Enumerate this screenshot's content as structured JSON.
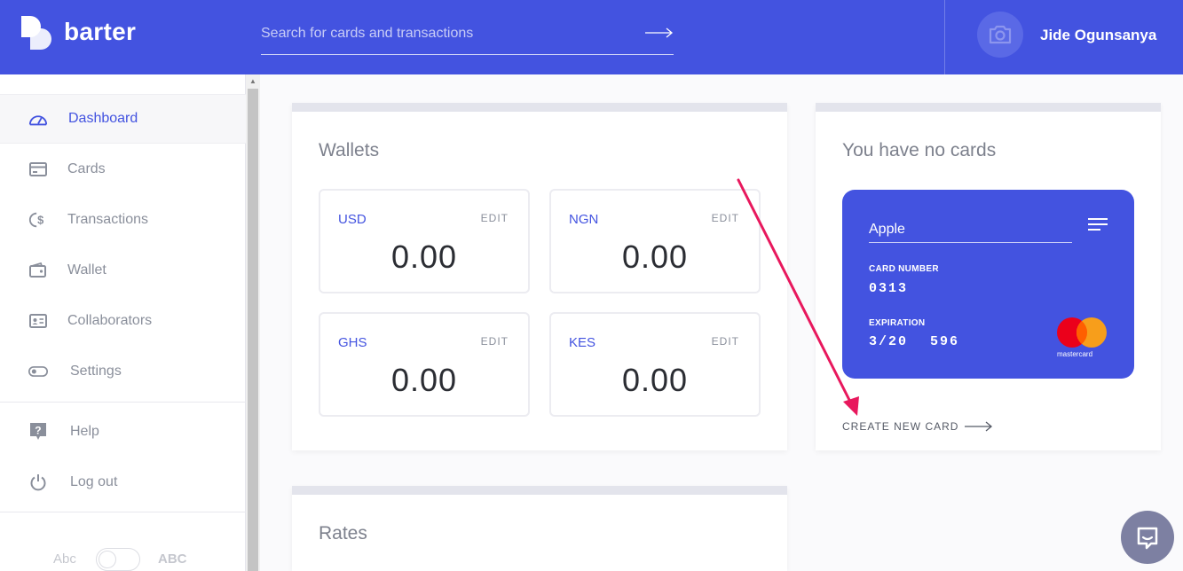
{
  "app": {
    "name": "barter"
  },
  "search": {
    "placeholder": "Search for cards and transactions"
  },
  "user": {
    "name": "Jide Ogunsanya"
  },
  "sidebar": {
    "items": [
      {
        "label": "Dashboard",
        "icon": "dashboard-icon",
        "active": true
      },
      {
        "label": "Cards",
        "icon": "card-icon"
      },
      {
        "label": "Transactions",
        "icon": "transactions-icon"
      },
      {
        "label": "Wallet",
        "icon": "wallet-icon"
      },
      {
        "label": "Collaborators",
        "icon": "collaborators-icon"
      },
      {
        "label": "Settings",
        "icon": "settings-icon"
      },
      {
        "label": "Help",
        "icon": "help-icon"
      },
      {
        "label": "Log out",
        "icon": "power-icon"
      }
    ],
    "text_size": {
      "small": "Abc",
      "large": "ABC"
    }
  },
  "wallets": {
    "title": "Wallets",
    "items": [
      {
        "currency": "USD",
        "edit": "EDIT",
        "amount": "0.00"
      },
      {
        "currency": "NGN",
        "edit": "EDIT",
        "amount": "0.00"
      },
      {
        "currency": "GHS",
        "edit": "EDIT",
        "amount": "0.00"
      },
      {
        "currency": "KES",
        "edit": "EDIT",
        "amount": "0.00"
      }
    ]
  },
  "cards": {
    "title": "You have no cards",
    "card": {
      "name": "Apple",
      "number_label": "CARD NUMBER",
      "number": "0313",
      "expiration_label": "EXPIRATION",
      "expiration": "3/20",
      "cvv": "596",
      "brand": "mastercard"
    },
    "create_label": "CREATE NEW CARD"
  },
  "rates": {
    "title": "Rates"
  },
  "colors": {
    "primary": "#4353e0",
    "annotation": "#e8185d"
  }
}
